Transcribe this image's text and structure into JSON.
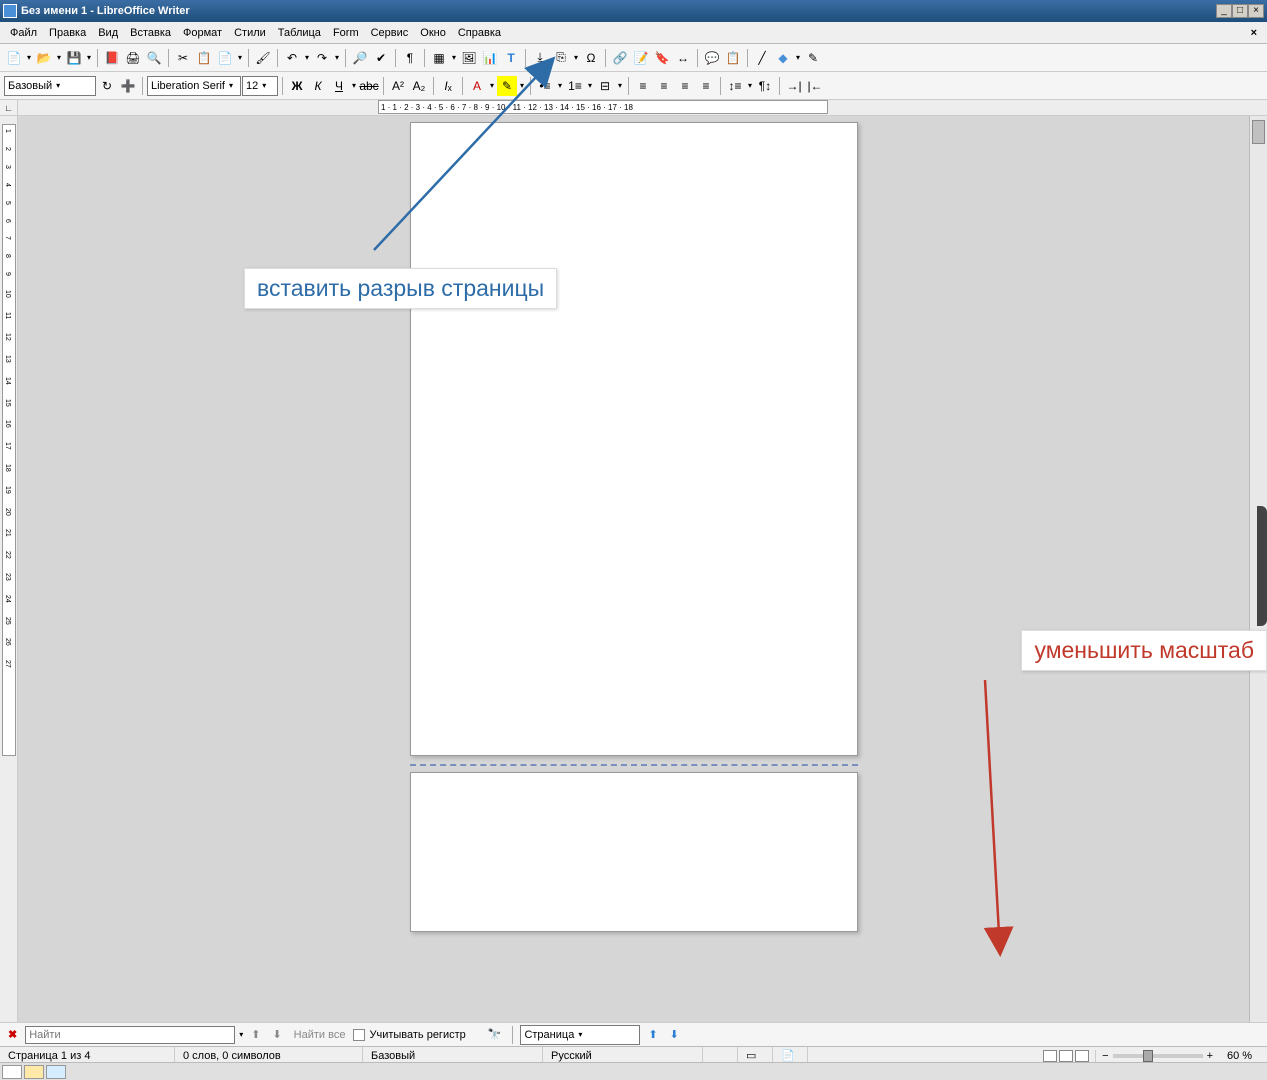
{
  "window": {
    "title": "Без имени 1 - LibreOffice Writer"
  },
  "menu": {
    "file": "Файл",
    "edit": "Правка",
    "view": "Вид",
    "insert": "Вставка",
    "format": "Формат",
    "styles": "Стили",
    "table": "Таблица",
    "form": "Form",
    "tools": "Сервис",
    "window": "Окно",
    "help": "Справка",
    "close": "×"
  },
  "format": {
    "style": "Базовый",
    "font": "Liberation Serif",
    "size": "12"
  },
  "ruler": {
    "marks": "1 · 1 · 2 · 3 · 4 · 5 · 6 · 7 · 8 · 9 · 10 · 11 · 12 · 13 · 14 · 15 · 16 · 17 · 18",
    "vmarks": [
      "1",
      "2",
      "3",
      "4",
      "5",
      "6",
      "7",
      "8",
      "9",
      "10",
      "11",
      "12",
      "13",
      "14",
      "15",
      "16",
      "17",
      "18",
      "19",
      "20",
      "21",
      "22",
      "23",
      "24",
      "25",
      "26",
      "27"
    ]
  },
  "find": {
    "placeholder": "Найти",
    "findall": "Найти все",
    "matchcase": "Учитывать регистр",
    "navtype": "Страница"
  },
  "status": {
    "page": "Страница 1 из 4",
    "words": "0 слов, 0 символов",
    "style": "Базовый",
    "lang": "Русский",
    "zoom": "60 %"
  },
  "annotations": {
    "pagebreak": "вставить разрыв страницы",
    "zoomout": "уменьшить масштаб"
  }
}
